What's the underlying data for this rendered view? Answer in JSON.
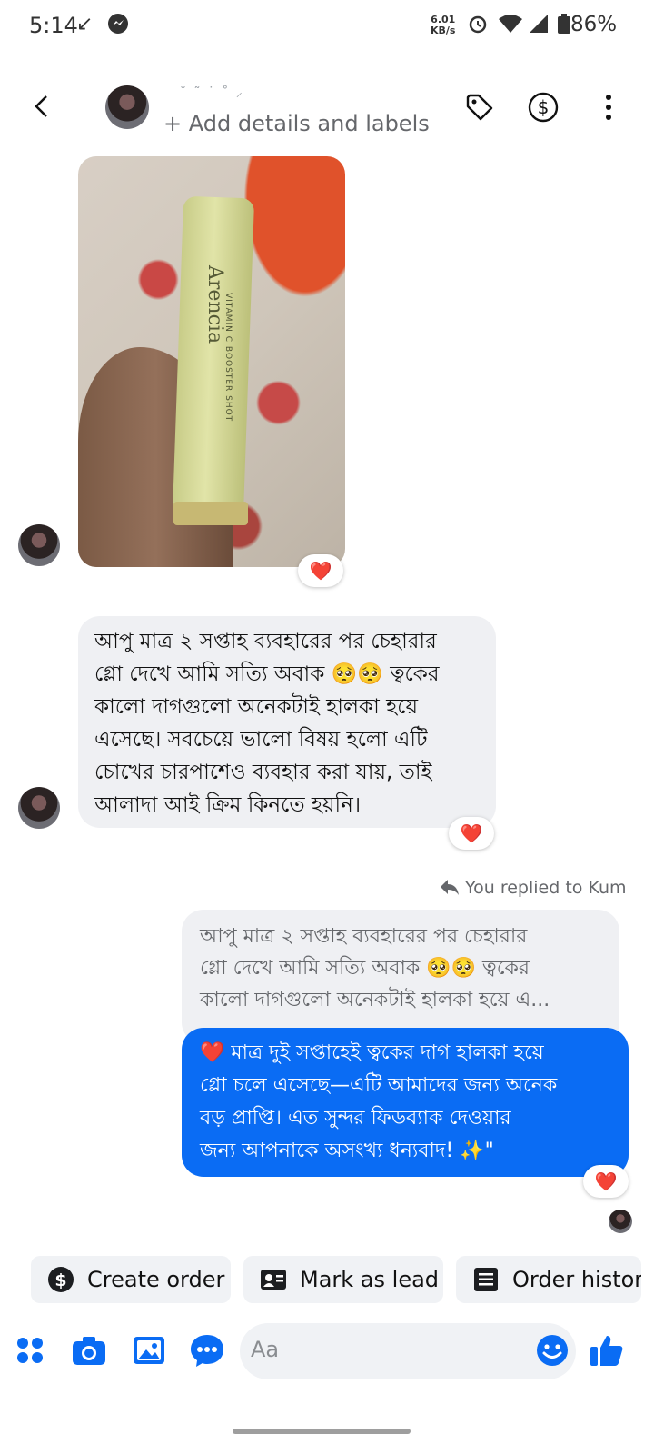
{
  "status_bar": {
    "time": "5:14",
    "network_speed_value": "6.01",
    "network_speed_unit": "KB/s",
    "battery": "86%"
  },
  "header": {
    "contact_name": "˘ ˜ ˙ ˚ ⸝",
    "subtitle": "+ Add details and labels",
    "icons": [
      "back-icon",
      "tag-icon",
      "dollar-icon",
      "more-icon"
    ]
  },
  "photo_message": {
    "brand": "Arencia",
    "product_line": "VITAMIN C BOOSTER SHOT",
    "reaction": "❤️"
  },
  "incoming_message": {
    "lines": [
      "আপু মাত্র ২ সপ্তাহ ব্যবহারের পর চেহারার",
      "গ্লো দেখে আমি সত্যি অবাক 🥺🥺 ত্বকের",
      "কালো দাগগুলো অনেকটাই হালকা হয়ে",
      "এসেছে। সবচেয়ে ভালো বিষয় হলো এটি",
      "চোখের চারপাশেও ব্যবহার করা যায়, তাই",
      "আলাদা আই ক্রিম কিনতে হয়নি।"
    ],
    "reaction": "❤️"
  },
  "reply": {
    "label": "You replied to Kum",
    "quoted_lines": [
      "আপু মাত্র ২ সপ্তাহ ব্যবহারের পর চেহারার",
      "গ্লো দেখে আমি সত্যি অবাক 🥺🥺 ত্বকের",
      "কালো দাগগুলো অনেকটাই হালকা হয়ে এ..."
    ],
    "message_lines": [
      "❤️ মাত্র দুই সপ্তাহেই ত্বকের দাগ হালকা হয়ে",
      "গ্লো চলে এসেছে—এটি আমাদের জন্য অনেক",
      "বড় প্রাপ্তি। এত সুন্দর ফিডব্যাক দেওয়ার",
      "জন্য আপনাকে অসংখ্য ধন্যবাদ! ✨\""
    ],
    "reaction": "❤️"
  },
  "quick_actions": [
    {
      "label": "Create order",
      "icon": "dollar-circle-icon"
    },
    {
      "label": "Mark as lead",
      "icon": "contact-card-icon"
    },
    {
      "label": "Order history",
      "icon": "list-document-icon"
    }
  ],
  "composer": {
    "placeholder": "Aa",
    "icons": [
      "apps-icon",
      "camera-icon",
      "gallery-icon",
      "chat-bubble-icon",
      "emoji-icon",
      "like-icon"
    ]
  },
  "colors": {
    "accent": "#0a6cf4",
    "bubble_incoming": "#eff0f3",
    "reaction_heart": "#e41e3f"
  }
}
